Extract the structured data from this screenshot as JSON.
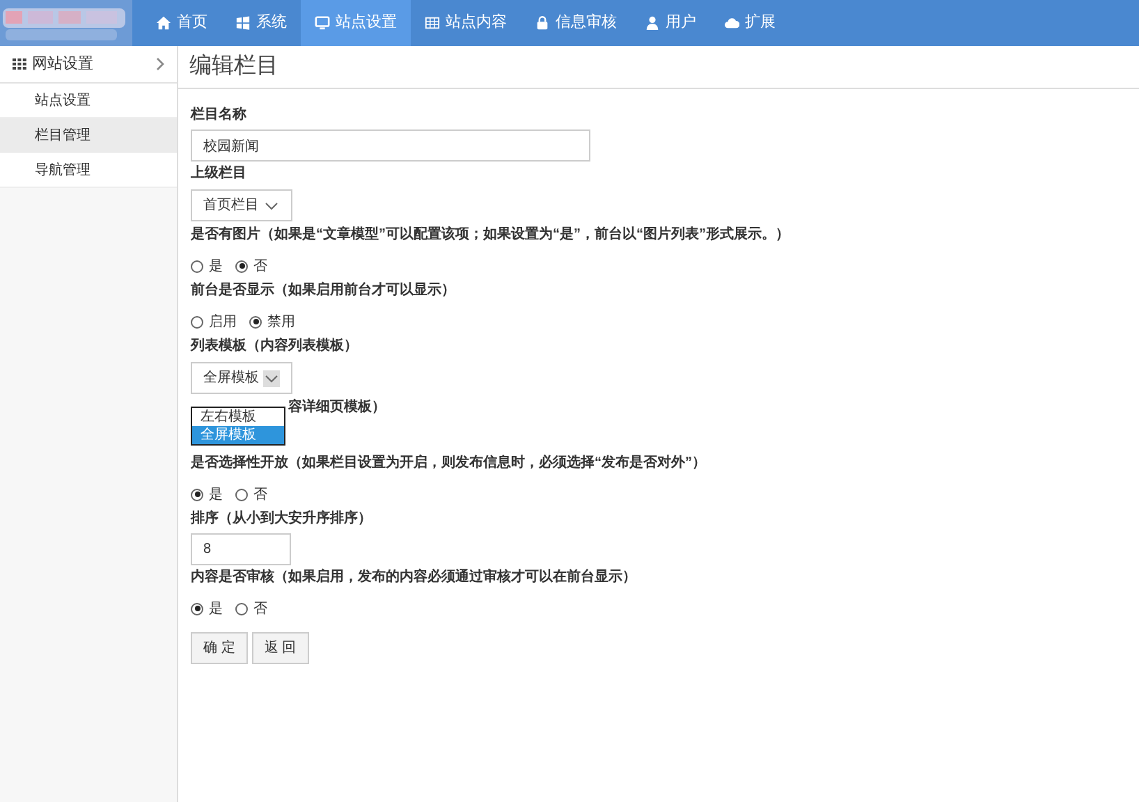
{
  "nav": [
    {
      "label": "首页",
      "selected": false
    },
    {
      "label": "系统",
      "selected": false
    },
    {
      "label": "站点设置",
      "selected": true
    },
    {
      "label": "站点内容",
      "selected": false
    },
    {
      "label": "信息审核",
      "selected": false
    },
    {
      "label": "用户",
      "selected": false
    },
    {
      "label": "扩展",
      "selected": false
    }
  ],
  "sidebar": {
    "header": "网站设置",
    "items": [
      {
        "label": "站点设置",
        "selected": false
      },
      {
        "label": "栏目管理",
        "selected": true
      },
      {
        "label": "导航管理",
        "selected": false
      }
    ]
  },
  "page_title": "编辑栏目",
  "form": [
    {
      "kind": "text",
      "label": "栏目名称",
      "value": "校园新闻"
    },
    {
      "kind": "select",
      "label": "上级栏目",
      "value": "首页栏目"
    },
    {
      "kind": "radio",
      "label": "是否有图片（如果是“文章模型”可以配置该项；如果设置为“是”，前台以“图片列表”形式展示。）",
      "options": [
        {
          "label": "是",
          "selected": false
        },
        {
          "label": "否",
          "selected": true
        }
      ]
    },
    {
      "kind": "radio",
      "label": "前台是否显示（如果启用前台才可以显示）",
      "options": [
        {
          "label": "启用",
          "selected": false
        },
        {
          "label": "禁用",
          "selected": true
        }
      ]
    },
    {
      "kind": "select",
      "label": "列表模板（内容列表模板）",
      "value": "全屏模板",
      "open": true,
      "options": [
        {
          "label": "左右模板",
          "selected": false
        },
        {
          "label": "全屏模板",
          "selected": true
        }
      ]
    },
    {
      "kind": "covered",
      "label": "容详细页模板）"
    },
    {
      "kind": "radio",
      "label": "是否选择性开放（如果栏目设置为开启，则发布信息时，必须选择“发布是否对外”）",
      "options": [
        {
          "label": "是",
          "selected": true
        },
        {
          "label": "否",
          "selected": false
        }
      ]
    },
    {
      "kind": "text",
      "label": "排序（从小到大安升序排序）",
      "value": "8"
    },
    {
      "kind": "radio",
      "label": "内容是否审核（如果启用，发布的内容必须通过审核才可以在前台显示）",
      "options": [
        {
          "label": "是",
          "selected": true
        },
        {
          "label": "否",
          "selected": false
        }
      ]
    }
  ],
  "buttons": [
    "确 定",
    "返 回"
  ]
}
